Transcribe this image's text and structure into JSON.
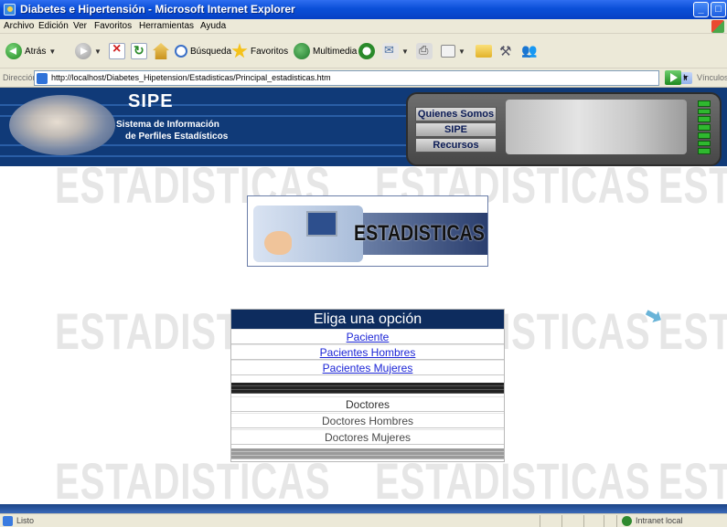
{
  "window": {
    "title": "Diabetes e Hipertensión - Microsoft Internet Explorer"
  },
  "menu": [
    "Archivo",
    "Edición",
    "Ver",
    "Favoritos",
    "Herramientas",
    "Ayuda"
  ],
  "toolbar": {
    "back_label": "Atrás",
    "search_label": "Búsqueda",
    "favorites_label": "Favoritos",
    "media_label": "Multimedia"
  },
  "address": {
    "label": "Dirección",
    "url": "http://localhost/Diabetes_Hipetension/Estadisticas/Principal_estadisticas.htm",
    "go_label": "Ir",
    "links_label": "Vínculos"
  },
  "header": {
    "title": "SIPE",
    "subtitle_line1": "Sistema de Información",
    "subtitle_line2": "de Perfiles Estadísticos",
    "nav": [
      "Quienes Somos",
      "SIPE",
      "Recursos"
    ]
  },
  "watermark": "ESTADISTICAS",
  "banner": {
    "text": "ESTADISTICAS"
  },
  "options": {
    "heading": "Eliga una opción",
    "patients": [
      "Paciente",
      "Pacientes Hombres",
      "Pacientes Mujeres"
    ],
    "doctors": [
      "Doctores",
      "Doctores Hombres",
      "Doctores Mujeres"
    ]
  },
  "status": {
    "text": "Listo",
    "zone": "Intranet local"
  }
}
